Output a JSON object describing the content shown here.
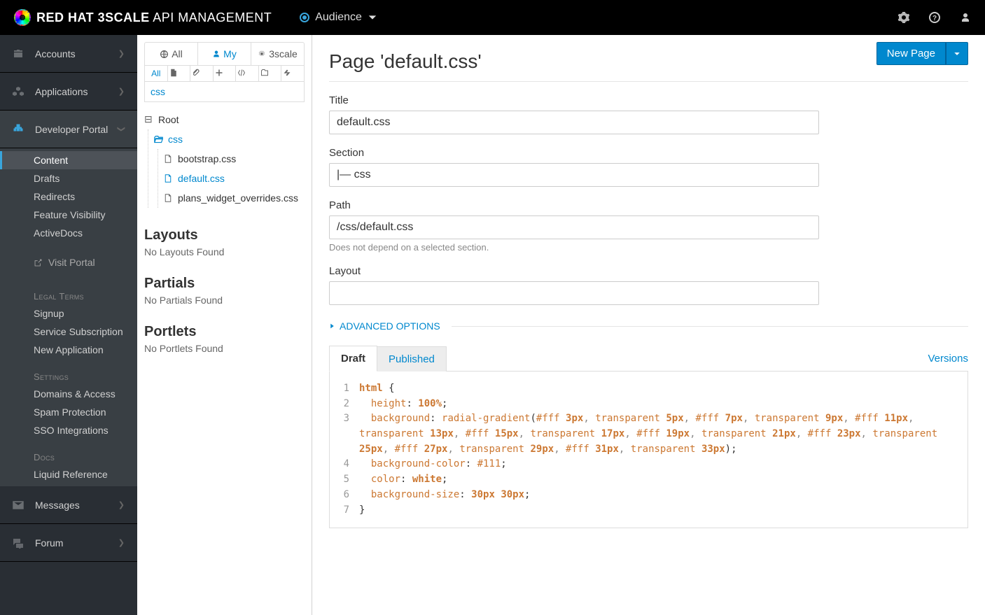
{
  "brand": {
    "bold": "RED HAT 3SCALE",
    "light": "API MANAGEMENT"
  },
  "context": {
    "label": "Audience"
  },
  "vnav": {
    "items": [
      {
        "label": "Accounts"
      },
      {
        "label": "Applications"
      },
      {
        "label": "Developer Portal"
      },
      {
        "label": "Messages"
      },
      {
        "label": "Forum"
      }
    ]
  },
  "subnav": {
    "items": [
      {
        "label": "Content"
      },
      {
        "label": "Drafts"
      },
      {
        "label": "Redirects"
      },
      {
        "label": "Feature Visibility"
      },
      {
        "label": "ActiveDocs"
      }
    ],
    "visit": "Visit Portal",
    "legal": {
      "heading": "Legal Terms",
      "items": [
        "Signup",
        "Service Subscription",
        "New Application"
      ]
    },
    "settings": {
      "heading": "Settings",
      "items": [
        "Domains & Access",
        "Spam Protection",
        "SSO Integrations"
      ]
    },
    "docs": {
      "heading": "Docs",
      "items": [
        "Liquid Reference"
      ]
    }
  },
  "contentTabs": {
    "all": "All",
    "my": "My",
    "threescale": "3scale"
  },
  "filterAll": "All",
  "search": {
    "value": "css"
  },
  "tree": {
    "root": "Root",
    "folder": "css",
    "files": [
      "bootstrap.css",
      "default.css",
      "plans_widget_overrides.css"
    ]
  },
  "sections": {
    "layouts": {
      "heading": "Layouts",
      "empty": "No Layouts Found"
    },
    "partials": {
      "heading": "Partials",
      "empty": "No Partials Found"
    },
    "portlets": {
      "heading": "Portlets",
      "empty": "No Portlets Found"
    }
  },
  "page": {
    "heading": "Page 'default.css'",
    "newPage": "New Page",
    "titleLabel": "Title",
    "titleValue": "default.css",
    "sectionLabel": "Section",
    "sectionValue": "|— css",
    "pathLabel": "Path",
    "pathValue": "/css/default.css",
    "pathHint": "Does not depend on a selected section.",
    "layoutLabel": "Layout",
    "layoutValue": "",
    "advanced": "ADVANCED OPTIONS",
    "tabs": {
      "draft": "Draft",
      "published": "Published",
      "versions": "Versions"
    }
  },
  "code": {
    "lines": [
      {
        "n": 1,
        "tokens": [
          [
            "sel",
            "html"
          ],
          [
            "punc",
            " {"
          ]
        ]
      },
      {
        "n": 2,
        "tokens": [
          [
            "prop",
            "  height"
          ],
          [
            "punc",
            ": "
          ],
          [
            "val",
            "100%"
          ],
          [
            "punc",
            ";"
          ]
        ]
      },
      {
        "n": 3,
        "tokens": [
          [
            "prop",
            "  background"
          ],
          [
            "punc",
            ": "
          ],
          [
            "func",
            "radial-gradient"
          ],
          [
            "punc",
            "("
          ],
          [
            "hex",
            "#fff"
          ],
          [
            "punc",
            " "
          ],
          [
            "val",
            "3px"
          ],
          [
            "comma",
            ", "
          ],
          [
            "kw",
            "transparent"
          ],
          [
            "punc",
            " "
          ],
          [
            "val",
            "5px"
          ],
          [
            "comma",
            ", "
          ],
          [
            "hex",
            "#fff"
          ],
          [
            "punc",
            " "
          ],
          [
            "val",
            "7px"
          ],
          [
            "comma",
            ", "
          ],
          [
            "kw",
            "transparent"
          ],
          [
            "punc",
            " "
          ],
          [
            "val",
            "9px"
          ],
          [
            "comma",
            ", "
          ],
          [
            "hex",
            "#fff"
          ],
          [
            "punc",
            " "
          ],
          [
            "val",
            "11px"
          ],
          [
            "comma",
            ", "
          ],
          [
            "kw",
            "transparent"
          ],
          [
            "punc",
            " "
          ],
          [
            "val",
            "13px"
          ],
          [
            "comma",
            ", "
          ],
          [
            "hex",
            "#fff"
          ],
          [
            "punc",
            " "
          ],
          [
            "val",
            "15px"
          ],
          [
            "comma",
            ", "
          ],
          [
            "kw",
            "transparent"
          ],
          [
            "punc",
            " "
          ],
          [
            "val",
            "17px"
          ],
          [
            "comma",
            ", "
          ],
          [
            "hex",
            "#fff"
          ],
          [
            "punc",
            " "
          ],
          [
            "val",
            "19px"
          ],
          [
            "comma",
            ", "
          ],
          [
            "kw",
            "transparent"
          ],
          [
            "punc",
            " "
          ],
          [
            "val",
            "21px"
          ],
          [
            "comma",
            ", "
          ],
          [
            "hex",
            "#fff"
          ],
          [
            "punc",
            " "
          ],
          [
            "val",
            "23px"
          ],
          [
            "comma",
            ", "
          ],
          [
            "kw",
            "transparent"
          ],
          [
            "punc",
            " "
          ],
          [
            "val",
            "25px"
          ],
          [
            "comma",
            ", "
          ],
          [
            "hex",
            "#fff"
          ],
          [
            "punc",
            " "
          ],
          [
            "val",
            "27px"
          ],
          [
            "comma",
            ", "
          ],
          [
            "kw",
            "transparent"
          ],
          [
            "punc",
            " "
          ],
          [
            "val",
            "29px"
          ],
          [
            "comma",
            ", "
          ],
          [
            "hex",
            "#fff"
          ],
          [
            "punc",
            " "
          ],
          [
            "val",
            "31px"
          ],
          [
            "comma",
            ", "
          ],
          [
            "kw",
            "transparent"
          ],
          [
            "punc",
            " "
          ],
          [
            "val",
            "33px"
          ],
          [
            "punc",
            ");"
          ]
        ]
      },
      {
        "n": 4,
        "tokens": [
          [
            "prop",
            "  background-color"
          ],
          [
            "punc",
            ": "
          ],
          [
            "hex",
            "#111"
          ],
          [
            "punc",
            ";"
          ]
        ]
      },
      {
        "n": 5,
        "tokens": [
          [
            "prop",
            "  color"
          ],
          [
            "punc",
            ": "
          ],
          [
            "val",
            "white"
          ],
          [
            "punc",
            ";"
          ]
        ]
      },
      {
        "n": 6,
        "tokens": [
          [
            "prop",
            "  background-size"
          ],
          [
            "punc",
            ": "
          ],
          [
            "val",
            "30px"
          ],
          [
            "punc",
            " "
          ],
          [
            "val",
            "30px"
          ],
          [
            "punc",
            ";"
          ]
        ]
      },
      {
        "n": 7,
        "tokens": [
          [
            "punc",
            "}"
          ]
        ]
      }
    ]
  }
}
